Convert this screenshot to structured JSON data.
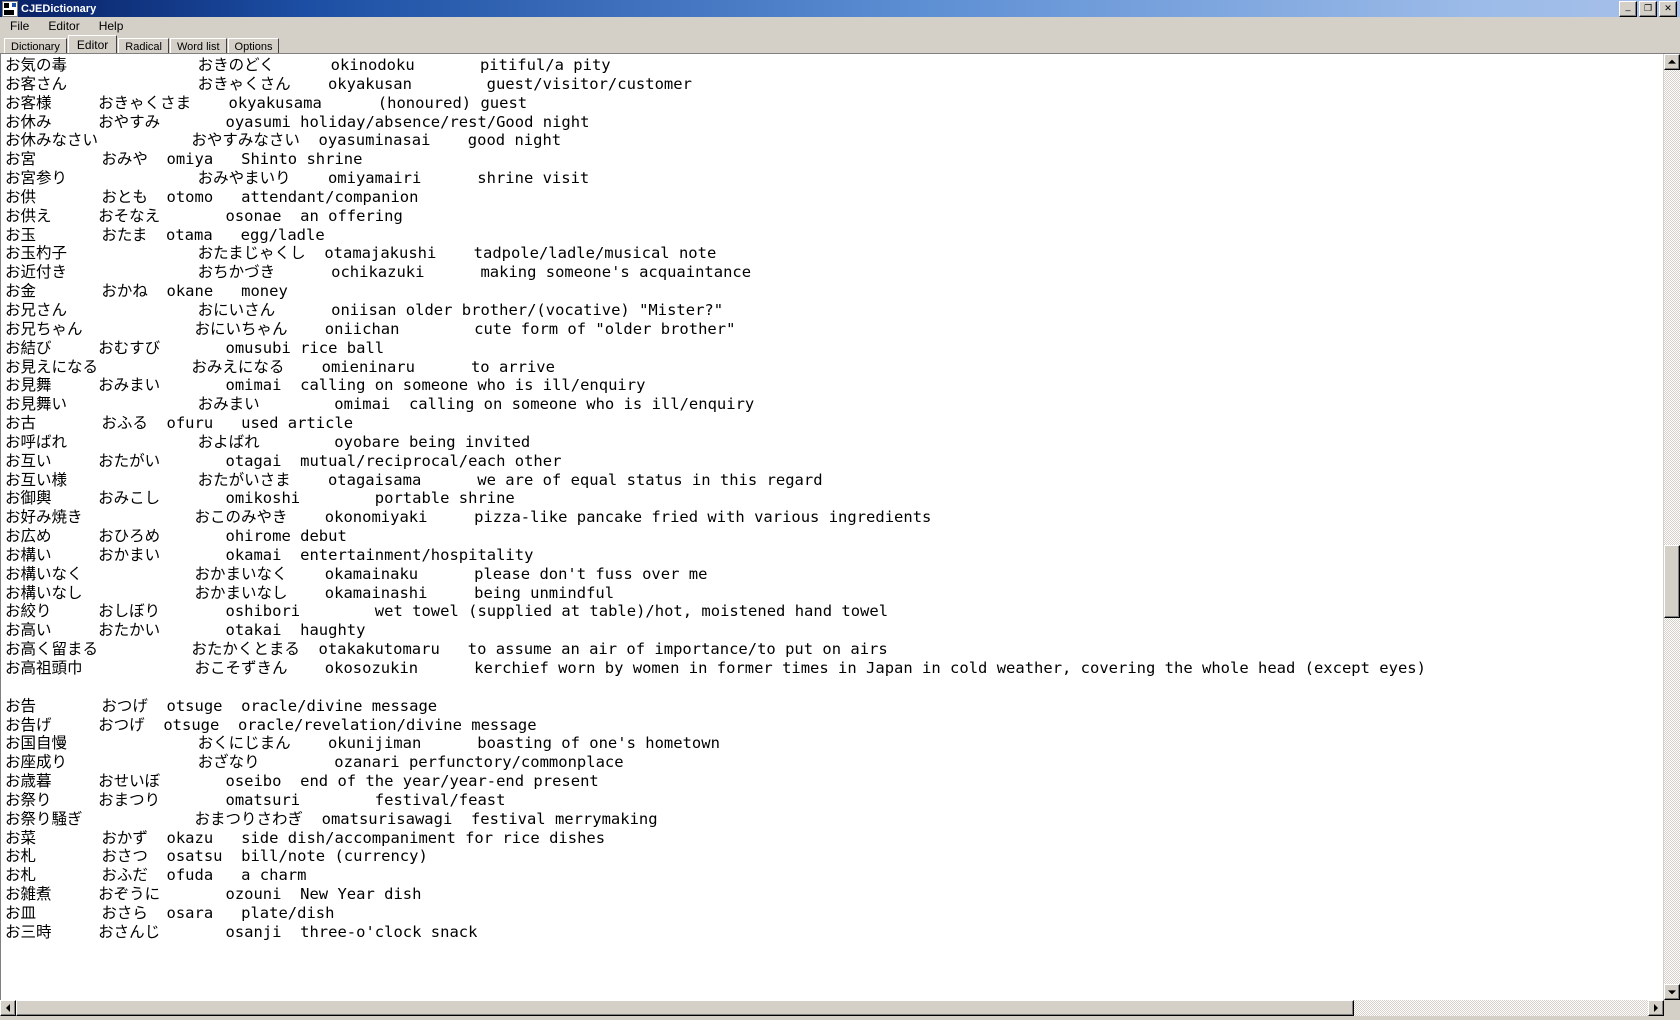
{
  "window": {
    "title": "CJEDictionary",
    "icon": "dictionary-icon",
    "buttons": {
      "minimize": "_",
      "maximize": "❐",
      "close": "✕"
    }
  },
  "menubar": {
    "items": [
      {
        "label": "File",
        "name": "menu-file"
      },
      {
        "label": "Editor",
        "name": "menu-editor"
      },
      {
        "label": "Help",
        "name": "menu-help"
      }
    ]
  },
  "tabs": {
    "active_index": 1,
    "items": [
      {
        "label": "Dictionary",
        "name": "tab-dictionary"
      },
      {
        "label": "Editor",
        "name": "tab-editor"
      },
      {
        "label": "Radical",
        "name": "tab-radical"
      },
      {
        "label": "Word list",
        "name": "tab-word-list"
      },
      {
        "label": "Options",
        "name": "tab-options"
      }
    ]
  },
  "editor": {
    "content": "お気の毒              おきのどく      okinodoku       pitiful/a pity\nお客さん              おきゃくさん    okyakusan        guest/visitor/customer\nお客様     おきゃくさま    okyakusama      (honoured) guest\nお休み     おやすみ       oyasumi holiday/absence/rest/Good night\nお休みなさい          おやすみなさい  oyasuminasai    good night\nお宮       おみや  omiya   Shinto shrine\nお宮参り              おみやまいり    omiyamairi      shrine visit\nお供       おとも  otomo   attendant/companion\nお供え     おそなえ       osonae  an offering\nお玉       おたま  otama   egg/ladle\nお玉杓子              おたまじゃくし  otamajakushi    tadpole/ladle/musical note\nお近付き              おちかづき      ochikazuki      making someone's acquaintance\nお金       おかね  okane   money\nお兄さん              おにいさん      oniisan older brother/(vocative) \"Mister?\"\nお兄ちゃん            おにいちゃん    oniichan        cute form of \"older brother\"\nお結び     おむすび       omusubi rice ball\nお見えになる          おみえになる    omieninaru      to arrive\nお見舞     おみまい       omimai  calling on someone who is ill/enquiry\nお見舞い              おみまい        omimai  calling on someone who is ill/enquiry\nお古       おふる  ofuru   used article\nお呼ばれ              およばれ        oyobare being invited\nお互い     おたがい       otagai  mutual/reciprocal/each other\nお互い様              おたがいさま    otagaisama      we are of equal status in this regard\nお御輿     おみこし       omikoshi        portable shrine\nお好み焼き            おこのみやき    okonomiyaki     pizza-like pancake fried with various ingredients\nお広め     おひろめ       ohirome debut\nお構い     おかまい       okamai  entertainment/hospitality\nお構いなく            おかまいなく    okamainaku      please don't fuss over me\nお構いなし            おかまいなし    okamainashi     being unmindful\nお絞り     おしぼり       oshibori        wet towel (supplied at table)/hot, moistened hand towel\nお高い     おたかい       otakai  haughty\nお高く留まる          おたかくとまる  otakakutomaru   to assume an air of importance/to put on airs\nお高祖頭巾            おこそずきん    okosozukin      kerchief worn by women in former times in Japan in cold weather, covering the whole head (except eyes)\n\nお告       おつげ  otsuge  oracle/divine message\nお告げ     おつげ  otsuge  oracle/revelation/divine message\nお国自慢              おくにじまん    okunijiman      boasting of one's hometown\nお座成り              おざなり        ozanari perfunctory/commonplace\nお歳暮     おせいぼ       oseibo  end of the year/year-end present\nお祭り     おまつり       omatsuri        festival/feast\nお祭り騒ぎ            おまつりさわぎ  omatsurisawagi  festival merrymaking\nお菜       おかず  okazu   side dish/accompaniment for rice dishes\nお札       おさつ  osatsu  bill/note (currency)\nお札       おふだ  ofuda   a charm\nお雑煮     おぞうに       ozouni  New Year dish\nお皿       おさら  osara   plate/dish\nお三時     おさんじ       osanji  three-o'clock snack\n"
  },
  "scrollbars": {
    "vertical": {
      "up_arrow": "up-arrow",
      "down_arrow": "down-arrow",
      "thumb_top_pct": 52,
      "thumb_height_pct": 8
    },
    "horizontal": {
      "left_arrow": "left-arrow",
      "right_arrow": "right-arrow",
      "thumb_left_pct": 0,
      "thumb_width_pct": 82
    }
  }
}
